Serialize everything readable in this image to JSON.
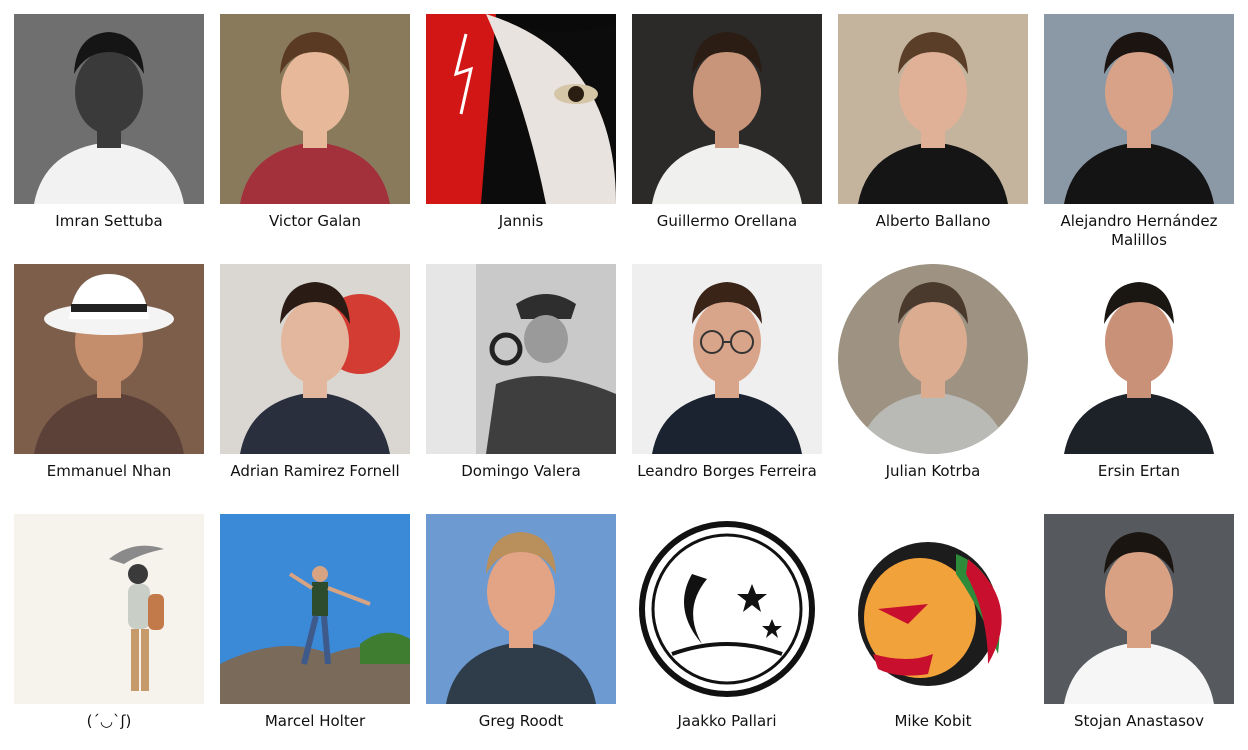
{
  "contributors": [
    {
      "name": "Imran Settuba",
      "avatar": "man-portrait-grayscale",
      "colors": {
        "bg": "#6f6f6f",
        "skin": "#3a3a3a",
        "hair": "#151515",
        "shirt": "#f2f2f2"
      }
    },
    {
      "name": "Victor Galan",
      "avatar": "man-portrait-outdoor",
      "colors": {
        "bg": "#8a7a5c",
        "skin": "#e8b89a",
        "hair": "#5a3a22",
        "shirt": "#a3313c"
      }
    },
    {
      "name": "Jannis",
      "avatar": "anime-illustration",
      "colors": {
        "bg": "#0c0c0c",
        "skin": "#e9e3df",
        "hair": "#0a0a0a",
        "shirt": "#d21616"
      }
    },
    {
      "name": "Guillermo Orellana",
      "avatar": "man-portrait-studio",
      "colors": {
        "bg": "#2c2a28",
        "skin": "#c8957a",
        "hair": "#2b1d14",
        "shirt": "#f0f0ef"
      }
    },
    {
      "name": "Alberto Ballano",
      "avatar": "man-portrait-indoor",
      "colors": {
        "bg": "#c4b49e",
        "skin": "#e0b197",
        "hair": "#5b3e28",
        "shirt": "#151515"
      }
    },
    {
      "name": "Alejandro Hernández Malillos",
      "avatar": "man-portrait-indoor",
      "colors": {
        "bg": "#8b98a6",
        "skin": "#d7a287",
        "hair": "#1c1410",
        "shirt": "#141414"
      }
    },
    {
      "name": "Emmanuel Nhan",
      "avatar": "man-with-white-hat",
      "colors": {
        "bg": "#7c5e4a",
        "skin": "#c48d6c",
        "hair": "#3b271b",
        "shirt": "#5c4138"
      }
    },
    {
      "name": "Adrian Ramirez Fornell",
      "avatar": "man-standing-indoor",
      "colors": {
        "bg": "#dad7d2",
        "skin": "#e3b79d",
        "hair": "#2a1c14",
        "shirt": "#2a2f3d"
      }
    },
    {
      "name": "Domingo Valera",
      "avatar": "detective-bw-photo",
      "colors": {
        "bg": "#c9c9c9",
        "skin": "#9a9a9a",
        "hair": "#2e2e2e",
        "shirt": "#3e3e3e"
      }
    },
    {
      "name": "Leandro Borges Ferreira",
      "avatar": "man-portrait-glasses",
      "colors": {
        "bg": "#efefef",
        "skin": "#d9a58a",
        "hair": "#3a2418",
        "shirt": "#1c2330"
      }
    },
    {
      "name": "Julian Kotrba",
      "avatar": "man-portrait-circle",
      "colors": {
        "bg": "#9e9383",
        "skin": "#dbac90",
        "hair": "#4a3a2d",
        "shirt": "#b9bab6"
      }
    },
    {
      "name": "Ersin Ertan",
      "avatar": "man-portrait-circle",
      "colors": {
        "bg": "#ffffff",
        "skin": "#c99178",
        "hair": "#1a1612",
        "shirt": "#1d2128"
      }
    },
    {
      "name": "(´◡`ʃ)",
      "avatar": "illustration-figure-bird",
      "colors": {
        "bg": "#f6f2ec",
        "skin": "#e6c7a6",
        "hair": "#3a3a3a",
        "shirt": "#c9cfc7"
      }
    },
    {
      "name": "Marcel Holter",
      "avatar": "man-on-rock-sky",
      "colors": {
        "bg": "#3a8ad8",
        "skin": "#d7a381",
        "hair": "#6a3a1e",
        "shirt": "#2d4c2d"
      }
    },
    {
      "name": "Greg Roodt",
      "avatar": "man-selfie-coast",
      "colors": {
        "bg": "#6d9ad0",
        "skin": "#e3a486",
        "hair": "#b98f5b",
        "shirt": "#2f3c4a"
      }
    },
    {
      "name": "Jaakko Pallari",
      "avatar": "moon-stars-drawing",
      "colors": {
        "bg": "#ffffff",
        "skin": "#ffffff",
        "hair": "#111111",
        "shirt": "#111111"
      }
    },
    {
      "name": "Mike Kobit",
      "avatar": "sports-team-logo",
      "colors": {
        "bg": "#ffffff",
        "skin": "#f2a23a",
        "hair": "#c8102e",
        "shirt": "#1c1c1c"
      }
    },
    {
      "name": "Stojan Anastasov",
      "avatar": "man-portrait-restaurant",
      "colors": {
        "bg": "#565a5e",
        "skin": "#d9a184",
        "hair": "#1b1511",
        "shirt": "#f6f6f6"
      }
    }
  ]
}
